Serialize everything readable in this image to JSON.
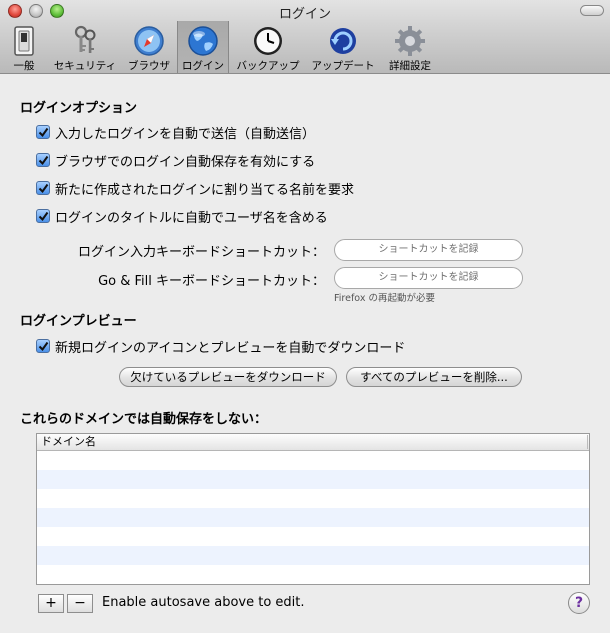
{
  "window": {
    "title": "ログイン"
  },
  "toolbar": {
    "items": [
      {
        "label": "一般",
        "icon": "switch-icon"
      },
      {
        "label": "セキュリティ",
        "icon": "keys-icon"
      },
      {
        "label": "ブラウザ",
        "icon": "compass-icon"
      },
      {
        "label": "ログイン",
        "icon": "globe-icon",
        "selected": true
      },
      {
        "label": "バックアップ",
        "icon": "clock-icon"
      },
      {
        "label": "アップデート",
        "icon": "update-icon"
      },
      {
        "label": "詳細設定",
        "icon": "gear-icon"
      }
    ]
  },
  "options": {
    "title": "ログインオプション",
    "checkboxes": [
      {
        "label": "入力したログインを自動で送信（自動送信）",
        "checked": true
      },
      {
        "label": "ブラウザでのログイン自動保存を有効にする",
        "checked": true
      },
      {
        "label": "新たに作成されたログインに割り当てる名前を要求",
        "checked": true
      },
      {
        "label": "ログインのタイトルに自動でユーザ名を含める",
        "checked": true
      }
    ],
    "shortcut_login_label": "ログイン入力キーボードショートカット：",
    "shortcut_gofill_label": "Go & Fill キーボードショートカット：",
    "shortcut_placeholder": "ショートカットを記録",
    "firefox_note": "Firefox の再起動が必要"
  },
  "preview": {
    "title": "ログインプレビュー",
    "checkbox_label": "新規ログインのアイコンとプレビューを自動でダウンロード",
    "download_button": "欠けているプレビューをダウンロード",
    "delete_button": "すべてのプレビューを削除..."
  },
  "domains": {
    "title": "これらのドメインでは自動保存をしない：",
    "column_header": "ドメイン名",
    "rows": [],
    "add_label": "+",
    "remove_label": "−",
    "status": "Enable autosave above to edit."
  },
  "help": {
    "label": "?"
  },
  "colors": {
    "checkbox_blue": "#4a90e8",
    "row_stripe": "#edf3fe",
    "help_purple": "#6c2fa0"
  }
}
